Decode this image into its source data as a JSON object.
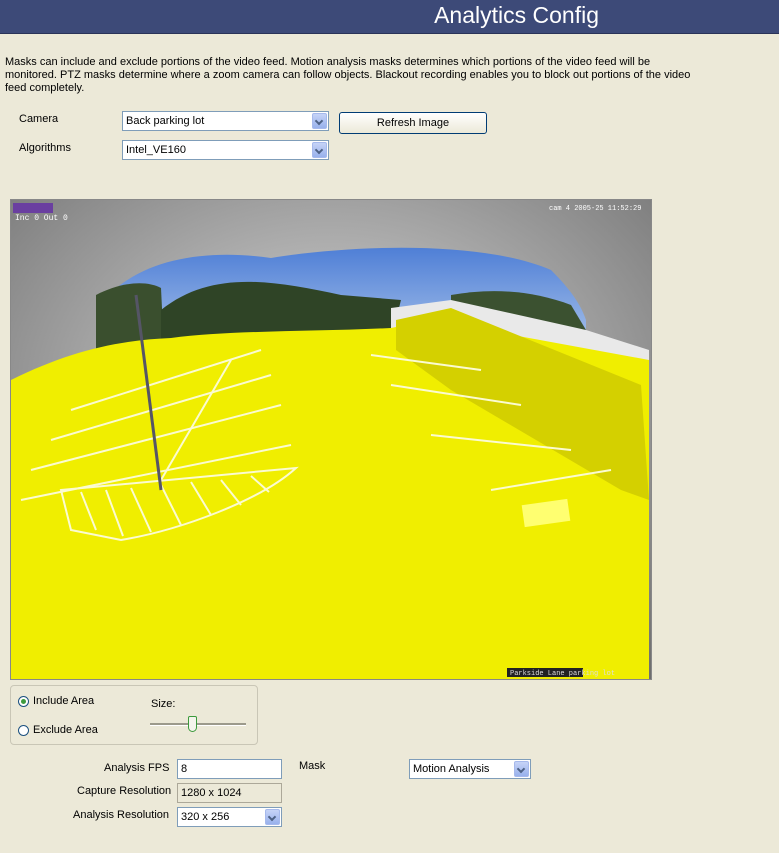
{
  "header": {
    "title": "Analytics Config"
  },
  "intro": "Masks can include and exclude portions of the video feed.  Motion analysis masks determines which portions of the video feed will be monitored.  PTZ masks determine where a zoom camera can follow objects.  Blackout recording enables you to block out portions of the video feed completely.",
  "camera": {
    "label": "Camera",
    "value": "Back parking lot"
  },
  "algorithms": {
    "label": "Algorithms",
    "value": "Intel_VE160"
  },
  "refresh_label": "Refresh Image",
  "video": {
    "overlay_top_left": "Inc 0 Out 0",
    "overlay_top_right": "cam 4 2005-25 11:52:29",
    "overlay_bottom_right": "Parkside Lane parking lot"
  },
  "mask_area": {
    "include_label": "Include Area",
    "exclude_label": "Exclude Area",
    "selected": "include",
    "size_label": "Size:",
    "size_level": 0.45
  },
  "settings": {
    "fps_label": "Analysis FPS",
    "fps_value": "8",
    "capture_label": "Capture Resolution",
    "capture_value": "1280 x 1024",
    "analysis_res_label": "Analysis Resolution",
    "analysis_res_value": "320 x 256",
    "mask_label": "Mask",
    "mask_value": "Motion Analysis"
  },
  "colors": {
    "header": "#3d4a78",
    "mask": "#f2f200"
  }
}
